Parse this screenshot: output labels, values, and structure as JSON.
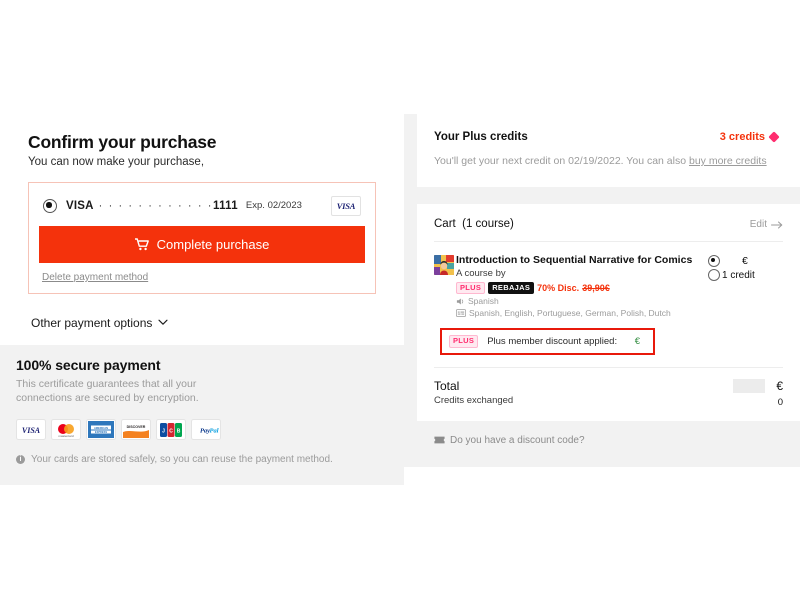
{
  "left": {
    "heading": "Confirm your purchase",
    "subheading": "You can now make your purchase,",
    "payment_method": {
      "brand": "VISA",
      "masked": "· · · · · · · · · · · ·",
      "last4": "1111",
      "expiry": "Exp. 02/2023",
      "brand_logo_label": "VISA",
      "selected": true
    },
    "complete_button": "Complete purchase",
    "delete_link": "Delete payment method",
    "other_options": "Other payment options",
    "secure": {
      "title": "100% secure payment",
      "description": "This certificate guarantees that all your connections are secured by encryption.",
      "cards": [
        "VISA",
        "mastercard",
        "AMERICAN EXPRESS",
        "DISCOVER",
        "JCB",
        "PayPal"
      ],
      "note": "Your cards are stored safely, so you can reuse the payment method."
    }
  },
  "right": {
    "credits": {
      "title": "Your Plus credits",
      "count_label": "3 credits",
      "next_credit_text_before": "You'll get your next credit on 02/19/2022. You can also ",
      "buy_more_link": "buy more credits"
    },
    "cart": {
      "title": "Cart",
      "count_label": "(1 course)",
      "edit_label": "Edit",
      "course": {
        "name": "Introduction to Sequential Narrative for Comics",
        "by_line": "A course by",
        "badge_plus": "PLUS",
        "badge_sale": "REBAJAS",
        "discount_pct": "70% Disc.",
        "old_price": "39,90€",
        "audio_language": "Spanish",
        "subtitle_languages": "Spanish, English, Portuguese, German, Polish, Dutch",
        "price_option_currency": "€",
        "credit_option_label": "1 credit",
        "price_selected": true,
        "credit_selected": false
      },
      "discount_applied": {
        "badge": "PLUS",
        "label": "Plus member discount applied:",
        "amount": "€"
      },
      "total": {
        "label": "Total",
        "sub_label": "Credits exchanged",
        "currency": "€",
        "credits_value": "0"
      },
      "discount_code_link": "Do you have a discount code?"
    }
  },
  "colors": {
    "accent_red": "#f4320c",
    "plus_pink": "#ff2d6f",
    "highlight_border": "#e8190b",
    "page_bg": "#f2f2f2",
    "green": "#2e8b3d"
  }
}
